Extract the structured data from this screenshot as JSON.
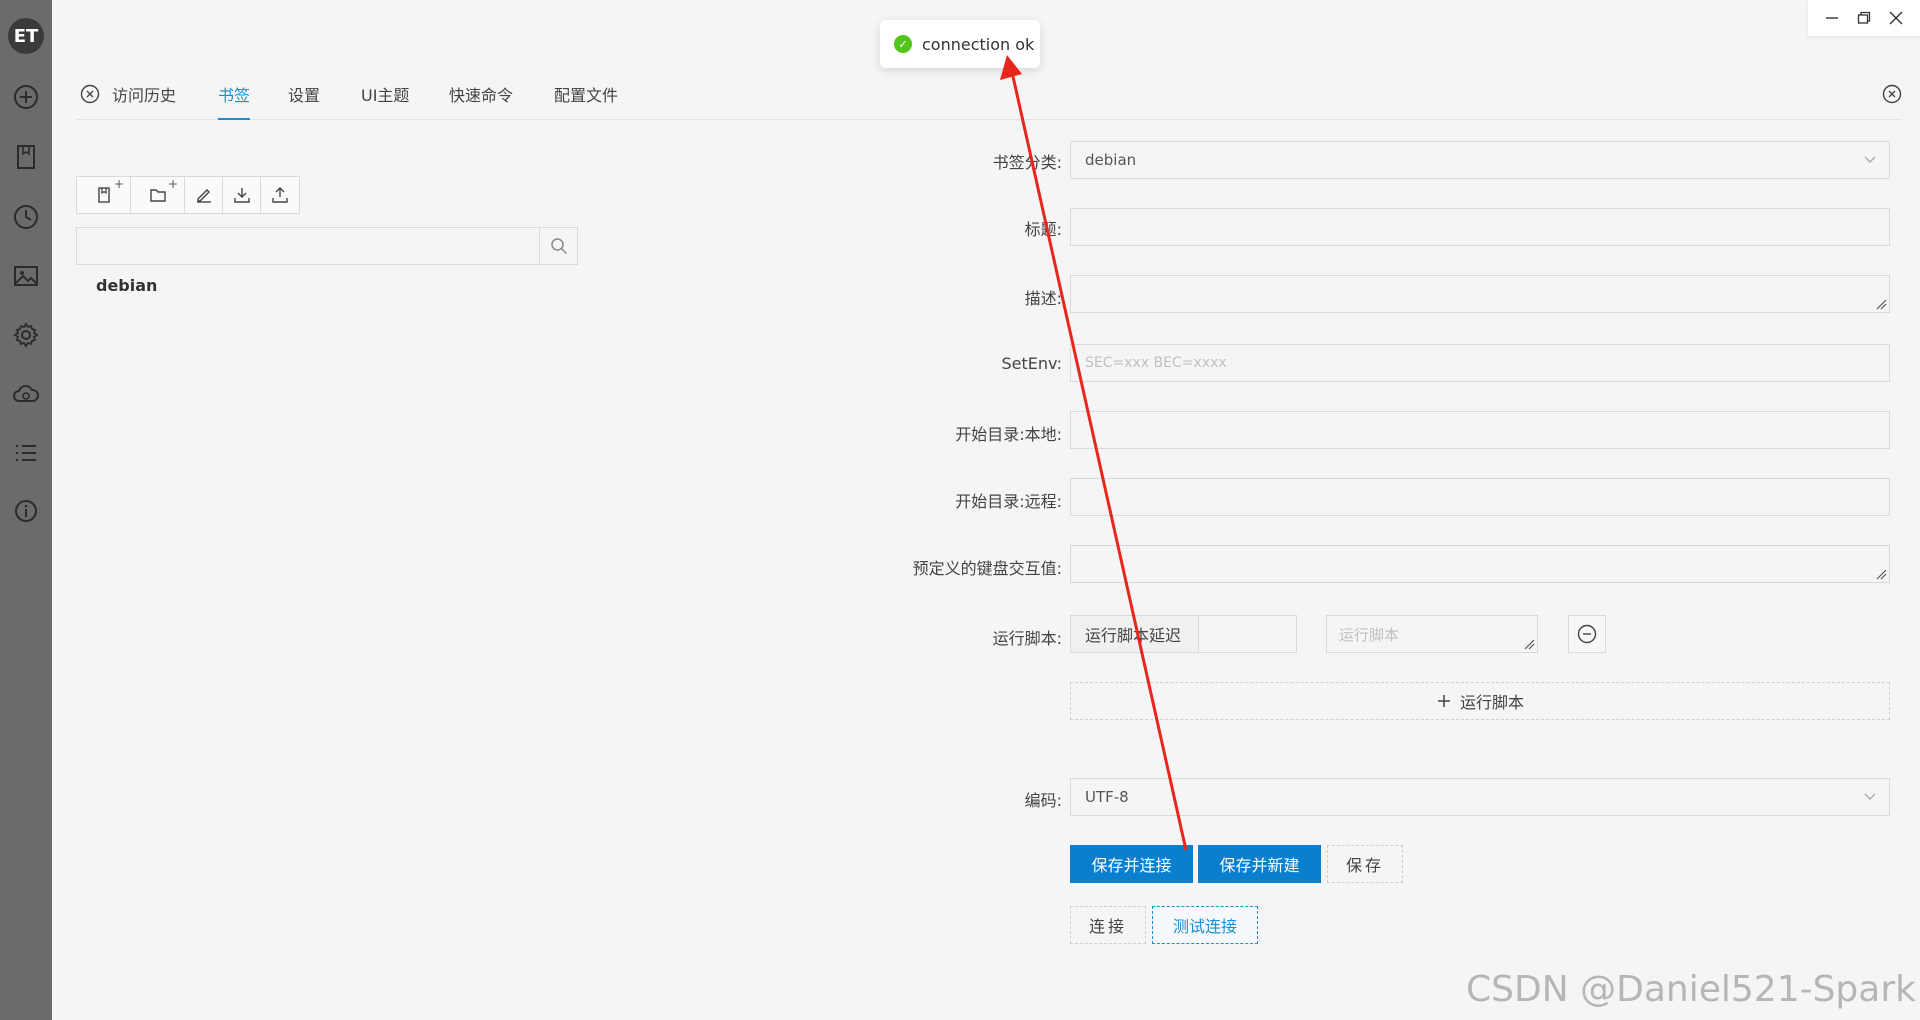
{
  "app": {
    "logo_text": "ET"
  },
  "toast": {
    "message": "connection ok"
  },
  "tabs": [
    {
      "label": "访问历史"
    },
    {
      "label": "书签"
    },
    {
      "label": "设置"
    },
    {
      "label": "UI主题"
    },
    {
      "label": "快速命令"
    },
    {
      "label": "配置文件"
    }
  ],
  "active_tab": "书签",
  "bookmarks": {
    "search_placeholder": "",
    "items": [
      "debian"
    ]
  },
  "form": {
    "category": {
      "label": "书签分类:",
      "value": "debian"
    },
    "title": {
      "label": "标题:",
      "value": ""
    },
    "description": {
      "label": "描述:",
      "value": ""
    },
    "setenv": {
      "label": "SetEnv:",
      "placeholder": "SEC=xxx BEC=xxxx"
    },
    "start_local": {
      "label": "开始目录:本地:",
      "value": ""
    },
    "start_remote": {
      "label": "开始目录:远程:",
      "value": ""
    },
    "predefined_keys": {
      "label": "预定义的键盘交互值:",
      "value": ""
    },
    "run_script": {
      "label": "运行脚本:",
      "delay_label": "运行脚本延迟",
      "script_placeholder": "运行脚本",
      "add_label": "运行脚本"
    },
    "encoding": {
      "label": "编码:",
      "value": "UTF-8"
    }
  },
  "buttons": {
    "save_connect": "保存并连接",
    "save_new": "保存并新建",
    "save": "保存",
    "connect": "连接",
    "test_connect": "测试连接"
  },
  "watermark": "CSDN @Daniel521-Spark",
  "colors": {
    "accent": "#1890d5",
    "primary_button": "#0a7fce",
    "success": "#52c41a",
    "annotation_arrow": "#e8261c"
  }
}
